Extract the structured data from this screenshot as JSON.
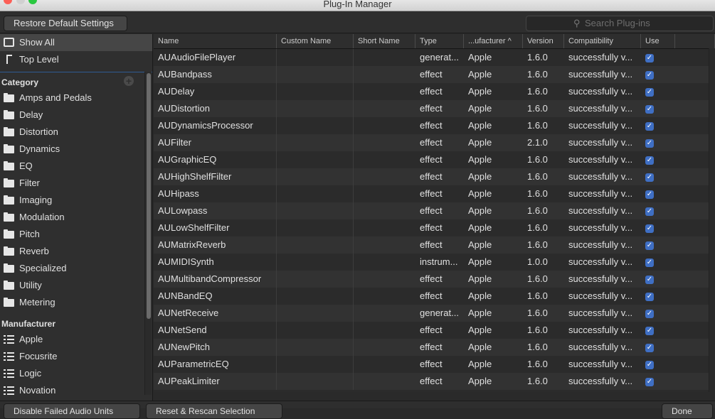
{
  "window": {
    "title": "Plug-In Manager"
  },
  "toolbar": {
    "restore_label": "Restore Default Settings",
    "search_placeholder": "Search Plug-ins"
  },
  "sidebar": {
    "top": [
      {
        "label": "Show All",
        "icon": "tray-icon",
        "selected": true
      },
      {
        "label": "Top Level",
        "icon": "arrow-up-icon"
      }
    ],
    "category_header": "Category",
    "categories": [
      "Amps and Pedals",
      "Delay",
      "Distortion",
      "Dynamics",
      "EQ",
      "Filter",
      "Imaging",
      "Modulation",
      "Pitch",
      "Reverb",
      "Specialized",
      "Utility",
      "Metering"
    ],
    "manufacturer_header": "Manufacturer",
    "manufacturers": [
      "Apple",
      "Focusrite",
      "Logic",
      "Novation"
    ]
  },
  "table": {
    "columns": [
      "Name",
      "Custom Name",
      "Short Name",
      "Type",
      "...ufacturer ^",
      "Version",
      "Compatibility",
      "Use"
    ],
    "rows": [
      [
        "AUAudioFilePlayer",
        "generat...",
        "Apple",
        "1.6.0"
      ],
      [
        "AUBandpass",
        "effect",
        "Apple",
        "1.6.0"
      ],
      [
        "AUDelay",
        "effect",
        "Apple",
        "1.6.0"
      ],
      [
        "AUDistortion",
        "effect",
        "Apple",
        "1.6.0"
      ],
      [
        "AUDynamicsProcessor",
        "effect",
        "Apple",
        "1.6.0"
      ],
      [
        "AUFilter",
        "effect",
        "Apple",
        "2.1.0"
      ],
      [
        "AUGraphicEQ",
        "effect",
        "Apple",
        "1.6.0"
      ],
      [
        "AUHighShelfFilter",
        "effect",
        "Apple",
        "1.6.0"
      ],
      [
        "AUHipass",
        "effect",
        "Apple",
        "1.6.0"
      ],
      [
        "AULowpass",
        "effect",
        "Apple",
        "1.6.0"
      ],
      [
        "AULowShelfFilter",
        "effect",
        "Apple",
        "1.6.0"
      ],
      [
        "AUMatrixReverb",
        "effect",
        "Apple",
        "1.6.0"
      ],
      [
        "AUMIDISynth",
        "instrum...",
        "Apple",
        "1.0.0"
      ],
      [
        "AUMultibandCompressor",
        "effect",
        "Apple",
        "1.6.0"
      ],
      [
        "AUNBandEQ",
        "effect",
        "Apple",
        "1.6.0"
      ],
      [
        "AUNetReceive",
        "generat...",
        "Apple",
        "1.6.0"
      ],
      [
        "AUNetSend",
        "effect",
        "Apple",
        "1.6.0"
      ],
      [
        "AUNewPitch",
        "effect",
        "Apple",
        "1.6.0"
      ],
      [
        "AUParametricEQ",
        "effect",
        "Apple",
        "1.6.0"
      ],
      [
        "AUPeakLimiter",
        "effect",
        "Apple",
        "1.6.0"
      ]
    ],
    "compatibility": "successfully v...",
    "use_checked": true
  },
  "bottom": {
    "disable_label": "Disable Failed Audio Units",
    "reset_label": "Reset & Rescan Selection",
    "done_label": "Done"
  }
}
